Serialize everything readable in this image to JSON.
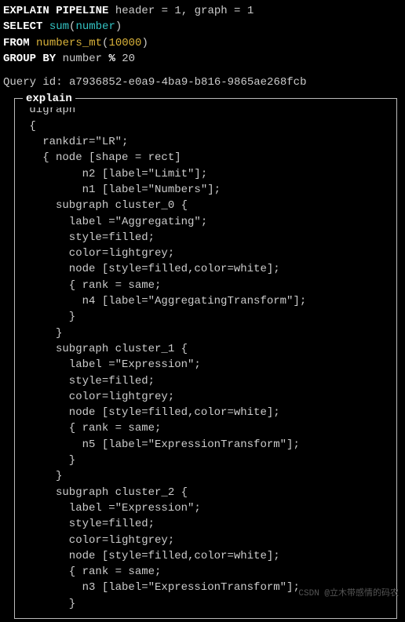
{
  "sql": {
    "l1": {
      "kw": "EXPLAIN PIPELINE",
      "rest": " header = 1, graph = 1"
    },
    "l2": {
      "kw": "SELECT",
      "sp": " ",
      "fn": "sum",
      "paren_open": "(",
      "arg": "number",
      "paren_close": ")"
    },
    "l3": {
      "kw": "FROM",
      "sp": " ",
      "tbl": "numbers_mt",
      "paren_open": "(",
      "num": "10000",
      "paren_close": ")"
    },
    "l4": {
      "kw": "GROUP BY",
      "sp": " ",
      "expr_a": "number ",
      "op": "%",
      "expr_b": " 20"
    }
  },
  "query_id_label": "Query id: ",
  "query_id_value": "a7936852-e0a9-4ba9-b816-9865ae268fcb",
  "box_title": "explain",
  "explain_body": " digraph\n {\n   rankdir=\"LR\";\n   { node [shape = rect]\n         n2 [label=\"Limit\"];\n         n1 [label=\"Numbers\"];\n     subgraph cluster_0 {\n       label =\"Aggregating\";\n       style=filled;\n       color=lightgrey;\n       node [style=filled,color=white];\n       { rank = same;\n         n4 [label=\"AggregatingTransform\"];\n       }\n     }\n     subgraph cluster_1 {\n       label =\"Expression\";\n       style=filled;\n       color=lightgrey;\n       node [style=filled,color=white];\n       { rank = same;\n         n5 [label=\"ExpressionTransform\"];\n       }\n     }\n     subgraph cluster_2 {\n       label =\"Expression\";\n       style=filled;\n       color=lightgrey;\n       node [style=filled,color=white];\n       { rank = same;\n         n3 [label=\"ExpressionTransform\"];\n       }",
  "watermark": "CSDN @立木带感情的码农"
}
